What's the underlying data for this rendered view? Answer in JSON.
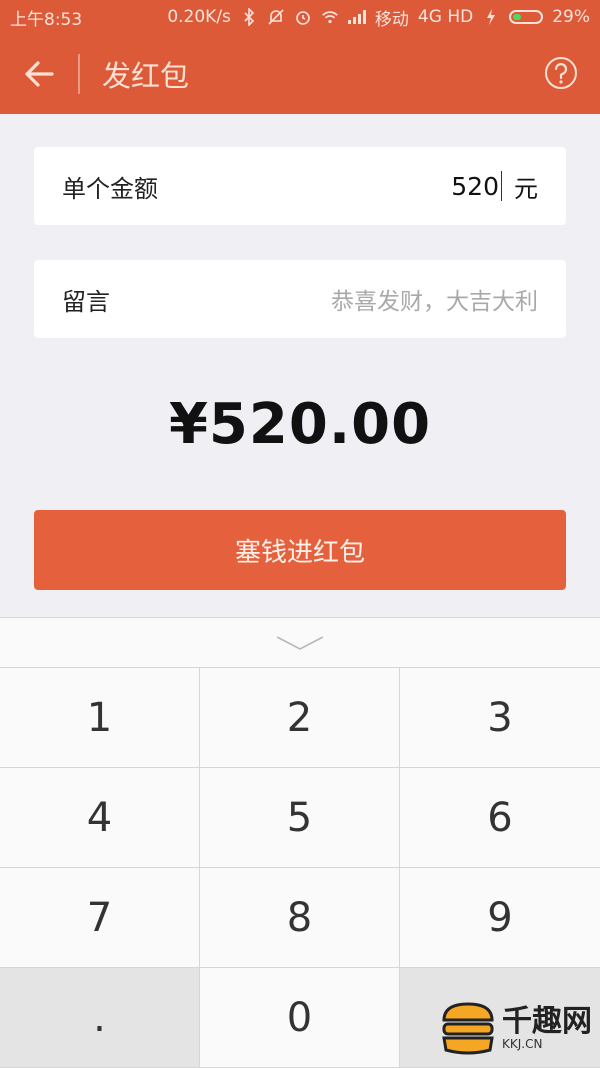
{
  "status_bar": {
    "time": "上午8:53",
    "speed": "0.20K/s",
    "carrier": "移动",
    "network": "4G HD",
    "battery_pct": "29%",
    "battery_fraction": 0.29
  },
  "header": {
    "title": "发红包"
  },
  "amount_row": {
    "label": "单个金额",
    "value": "520",
    "unit": "元"
  },
  "message_row": {
    "label": "留言",
    "placeholder": "恭喜发财，大吉大利"
  },
  "total": "¥520.00",
  "submit_label": "塞钱进红包",
  "keypad": {
    "keys": [
      "1",
      "2",
      "3",
      "4",
      "5",
      "6",
      "7",
      "8",
      "9",
      ".",
      "0",
      ""
    ]
  },
  "watermark": {
    "text": "千趣网",
    "sub": "KKJ.CN"
  },
  "colors": {
    "accent": "#dd5a39",
    "button": "#e5613d"
  }
}
